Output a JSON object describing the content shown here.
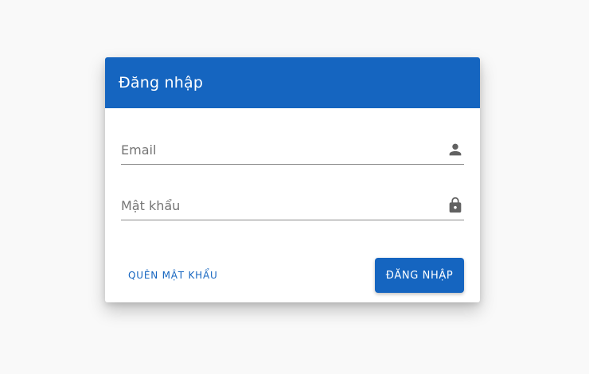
{
  "theme": {
    "primary_color": "#1565c0",
    "icon_color": "#616161"
  },
  "login_card": {
    "title": "Đăng nhập",
    "email_field": {
      "placeholder": "Email",
      "value": "",
      "icon": "person-icon"
    },
    "password_field": {
      "placeholder": "Mật khẩu",
      "value": "",
      "icon": "lock-icon"
    },
    "forgot_password_label": "Quên mật khẩu",
    "login_button_label": "Đăng nhập"
  }
}
